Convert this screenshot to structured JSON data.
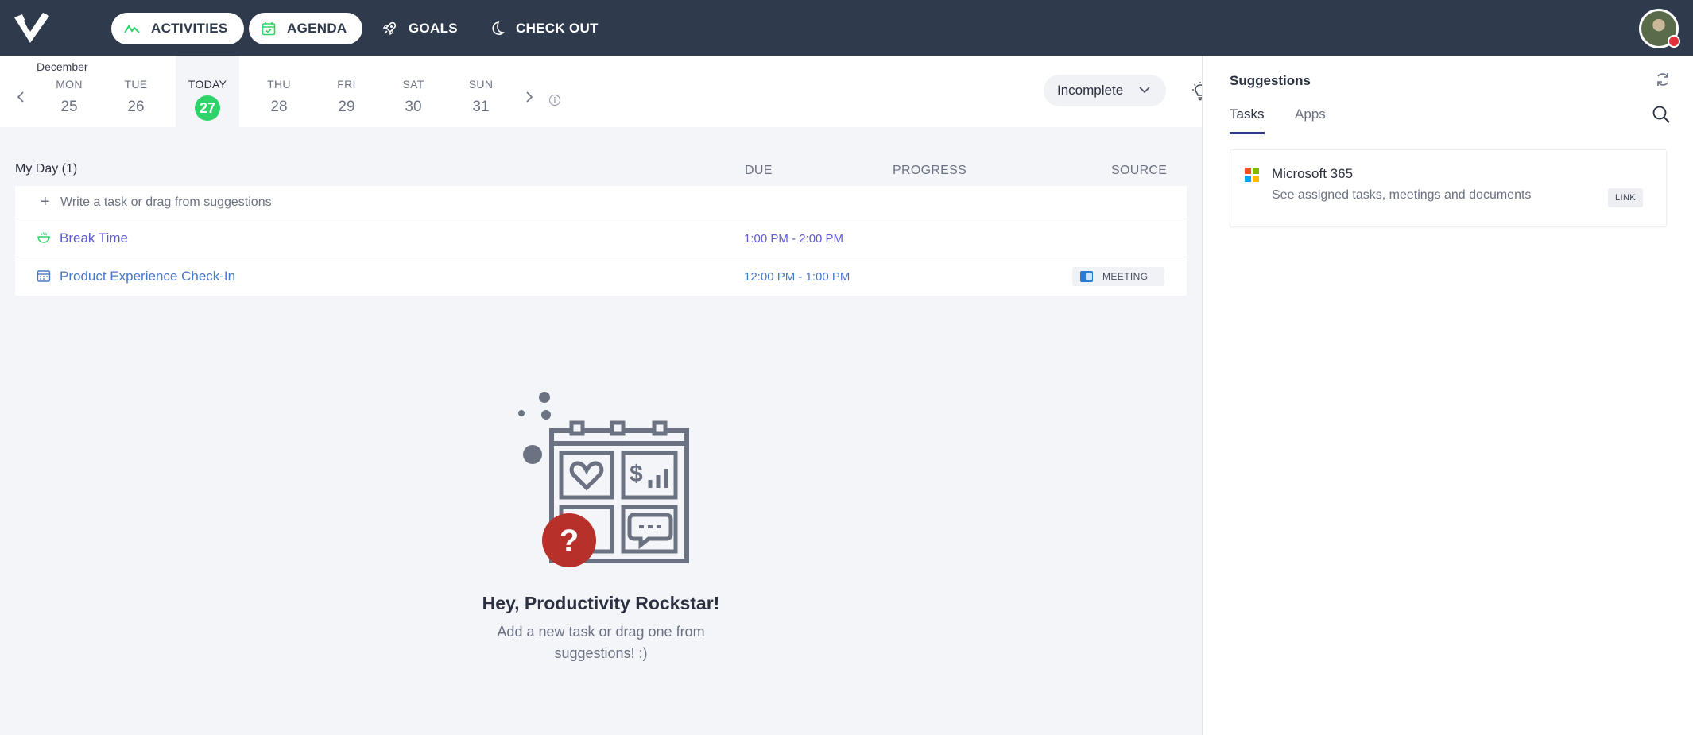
{
  "nav": {
    "activities": "ACTIVITIES",
    "agenda": "AGENDA",
    "goals": "GOALS",
    "checkout": "CHECK OUT"
  },
  "calendar": {
    "month": "December",
    "days": [
      {
        "name": "MON",
        "num": "25"
      },
      {
        "name": "TUE",
        "num": "26"
      },
      {
        "name": "TODAY",
        "num": "27"
      },
      {
        "name": "THU",
        "num": "28"
      },
      {
        "name": "FRI",
        "num": "29"
      },
      {
        "name": "SAT",
        "num": "30"
      },
      {
        "name": "SUN",
        "num": "31"
      }
    ],
    "filter": "Incomplete"
  },
  "list": {
    "title": "My Day (1)",
    "col_due": "DUE",
    "col_progress": "PROGRESS",
    "col_source": "SOURCE",
    "add_placeholder": "Write a task or drag from suggestions",
    "tasks": [
      {
        "name": "Break Time",
        "due": "1:00 PM - 2:00 PM",
        "source": ""
      },
      {
        "name": "Product Experience Check-In",
        "due": "12:00 PM - 1:00 PM",
        "source": "MEETING"
      }
    ]
  },
  "empty": {
    "title": "Hey, Productivity Rockstar!",
    "subtitle": "Add a new task or drag one from suggestions! :)"
  },
  "suggestions": {
    "title": "Suggestions",
    "tabs": [
      "Tasks",
      "Apps"
    ],
    "items": [
      {
        "name": "Microsoft 365",
        "desc": "See assigned tasks, meetings and documents",
        "action": "LINK"
      }
    ]
  },
  "colors": {
    "topbar": "#2f3a4c",
    "today": "#2ed36a",
    "task_purple": "#5f5ad4",
    "task_blue": "#4a78c8",
    "empty_badge": "#b8302a"
  }
}
